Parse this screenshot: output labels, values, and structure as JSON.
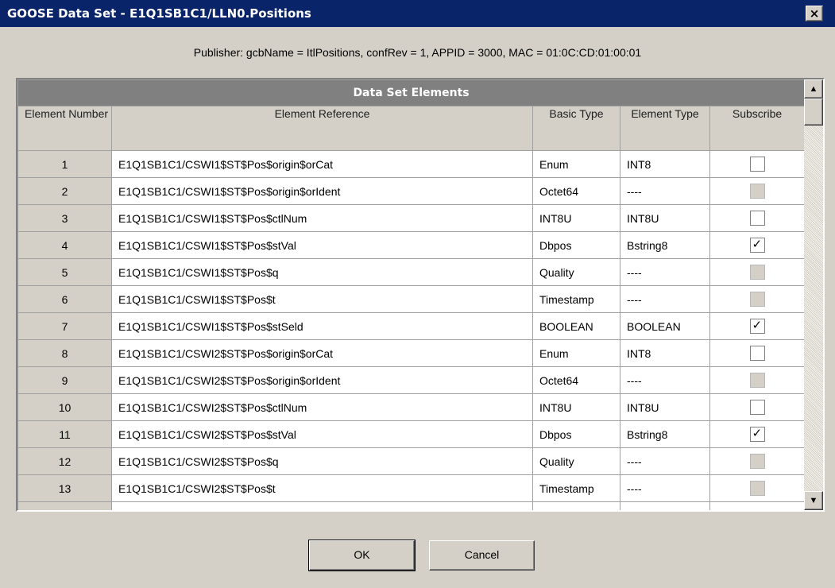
{
  "window": {
    "title": "GOOSE Data Set - E1Q1SB1C1/LLN0.Positions",
    "close_glyph": "×"
  },
  "publisher": "Publisher: gcbName = ItlPositions, confRev = 1, APPID = 3000, MAC = 01:0C:CD:01:00:01",
  "grid": {
    "title": "Data Set Elements",
    "headers": {
      "element_number": "Element Number",
      "element_reference": "Element Reference",
      "basic_type": "Basic Type",
      "element_type": "Element Type",
      "subscribe": "Subscribe"
    },
    "rows": [
      {
        "num": "1",
        "ref": "E1Q1SB1C1/CSWI1$ST$Pos$origin$orCat",
        "basic": "Enum",
        "etype": "INT8",
        "sub": "unchecked"
      },
      {
        "num": "2",
        "ref": "E1Q1SB1C1/CSWI1$ST$Pos$origin$orIdent",
        "basic": "Octet64",
        "etype": "----",
        "sub": "disabled"
      },
      {
        "num": "3",
        "ref": "E1Q1SB1C1/CSWI1$ST$Pos$ctlNum",
        "basic": "INT8U",
        "etype": "INT8U",
        "sub": "unchecked"
      },
      {
        "num": "4",
        "ref": "E1Q1SB1C1/CSWI1$ST$Pos$stVal",
        "basic": "Dbpos",
        "etype": "Bstring8",
        "sub": "checked"
      },
      {
        "num": "5",
        "ref": "E1Q1SB1C1/CSWI1$ST$Pos$q",
        "basic": "Quality",
        "etype": "----",
        "sub": "disabled"
      },
      {
        "num": "6",
        "ref": "E1Q1SB1C1/CSWI1$ST$Pos$t",
        "basic": "Timestamp",
        "etype": "----",
        "sub": "disabled"
      },
      {
        "num": "7",
        "ref": "E1Q1SB1C1/CSWI1$ST$Pos$stSeld",
        "basic": "BOOLEAN",
        "etype": "BOOLEAN",
        "sub": "checked"
      },
      {
        "num": "8",
        "ref": "E1Q1SB1C1/CSWI2$ST$Pos$origin$orCat",
        "basic": "Enum",
        "etype": "INT8",
        "sub": "unchecked"
      },
      {
        "num": "9",
        "ref": "E1Q1SB1C1/CSWI2$ST$Pos$origin$orIdent",
        "basic": "Octet64",
        "etype": "----",
        "sub": "disabled"
      },
      {
        "num": "10",
        "ref": "E1Q1SB1C1/CSWI2$ST$Pos$ctlNum",
        "basic": "INT8U",
        "etype": "INT8U",
        "sub": "unchecked"
      },
      {
        "num": "11",
        "ref": "E1Q1SB1C1/CSWI2$ST$Pos$stVal",
        "basic": "Dbpos",
        "etype": "Bstring8",
        "sub": "checked"
      },
      {
        "num": "12",
        "ref": "E1Q1SB1C1/CSWI2$ST$Pos$q",
        "basic": "Quality",
        "etype": "----",
        "sub": "disabled"
      },
      {
        "num": "13",
        "ref": "E1Q1SB1C1/CSWI2$ST$Pos$t",
        "basic": "Timestamp",
        "etype": "----",
        "sub": "disabled"
      }
    ],
    "checkmark": "✓"
  },
  "scrollbar": {
    "up_icon": "scroll-up-arrow-icon",
    "down_icon": "scroll-down-arrow-icon",
    "up_glyph": "▲",
    "down_glyph": "▼"
  },
  "buttons": {
    "ok": "OK",
    "cancel": "Cancel"
  }
}
